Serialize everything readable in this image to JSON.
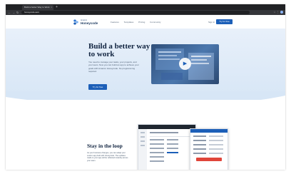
{
  "browser": {
    "tab_title": "Build a better Way to Work",
    "url": "honeycode.aws"
  },
  "header": {
    "logo_small": "Amazon",
    "logo_name": "Honeycode",
    "nav": [
      "Features",
      "Templates",
      "Pricing",
      "Community"
    ],
    "sign_in": "Sign in",
    "cta": "Try for free"
  },
  "hero": {
    "title": "Build a better way to work",
    "description": "You need to manage your tasks, your projects, and your team. Now you can build an app to achieve your goals with Amazon Honeycode. No programming required.",
    "cta": "Try for free"
  },
  "section2": {
    "title": "Stay in the loop",
    "description": "As your business changes, you can adapt your custom app built with Honeycode. The updates made to your app will be reflected instantly across your team."
  },
  "colors": {
    "brand_blue": "#1c5fb8",
    "heading": "#10233f",
    "hero_bg": "#dde9f7"
  }
}
